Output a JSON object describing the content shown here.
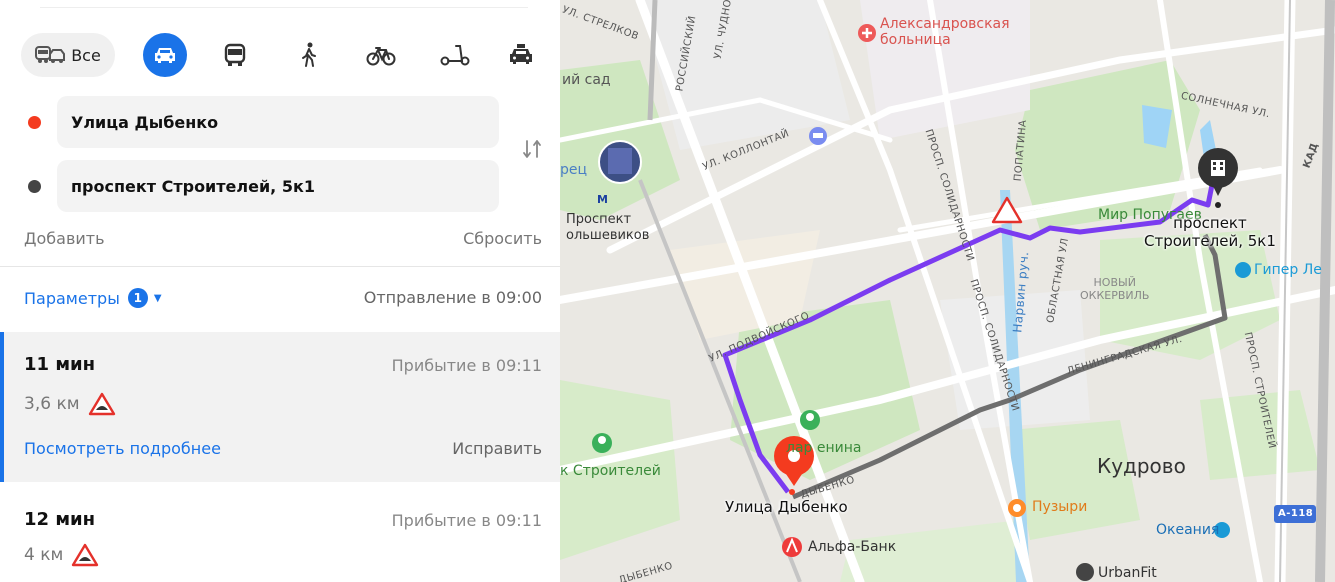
{
  "modes": {
    "all_label": "Все",
    "items": [
      "car-icon",
      "bus-icon",
      "walk-icon",
      "bicycle-icon",
      "scooter-icon",
      "taxi-icon"
    ],
    "selected": "car"
  },
  "route": {
    "from": "Улица Дыбенко",
    "to": "проспект Строителей, 5к1",
    "add_label": "Добавить",
    "reset_label": "Сбросить"
  },
  "options": {
    "params_label": "Параметры",
    "params_count": "1",
    "departure": "Отправление в 09:00"
  },
  "routes": [
    {
      "duration": "11 мин",
      "arrival": "Прибытие в 09:11",
      "distance": "3,6 км",
      "details_label": "Посмотреть подробнее",
      "fix_label": "Исправить"
    },
    {
      "duration": "12 мин",
      "arrival": "Прибытие в 09:11",
      "distance": "4 км"
    }
  ],
  "colors": {
    "accent": "#1a73e8",
    "route_main": "#7b3cf0",
    "route_alt": "#6e6e6e",
    "start_marker": "#f43b1f"
  },
  "map": {
    "streets": {
      "strelkov": "УЛ. СТРЕЛКОВ",
      "rossiyskiy": "РОССИЙСКИЙ",
      "chudnovo": "УЛ. ЧУДНОВ",
      "kollontai": "УЛ. КОЛЛОНТАЙ",
      "solidarnosti1": "ПРОСП. СОЛИДАРНОСТИ",
      "solidarnosti2": "ПРОСП. СОЛИДАРНОСТИ",
      "solnechnaya": "СОЛНЕЧНАЯ УЛ.",
      "lopatina": "ПОПАТИНА",
      "kad": "КАД",
      "podvoyskogo": "УЛ. ПОДВОЙСКОГО",
      "narvin": "Нарвин руч.",
      "oblastnaya": "ОБЛАСТНАЯ УЛ",
      "leningradskaya": "ЛЕНИНГРАДСКАЯ УЛ.",
      "stroiteley": "ПРОСП. СТРОИТЕЛЕЙ",
      "dybenko": "ДЫБЕНКО",
      "dybenko2": "ДЫБЕНКО",
      "a118": "А-118"
    },
    "pois": {
      "hospital": "Александровская\nбольница",
      "sad": "ий сад",
      "dvorec": "рец",
      "metro": "Проспект\nольшевиков",
      "mir": "Мир Попугаев",
      "giper": "Гипер Ле",
      "novyi": "НОВЫЙ\nОККЕРВИЛЬ",
      "park_lenina": "лар  енина",
      "stroiteley_park": "к Строителей",
      "puzyri": "Пузыри",
      "okeaniya": "Океания",
      "alfa": "Альфа-Банк",
      "urbanfit": "UrbanFit",
      "kudrovo": "Кудрово",
      "metro_m": "М"
    },
    "start_label": "Улица Дыбенко",
    "end_label": "проспект\nСтроителей, 5к1"
  }
}
